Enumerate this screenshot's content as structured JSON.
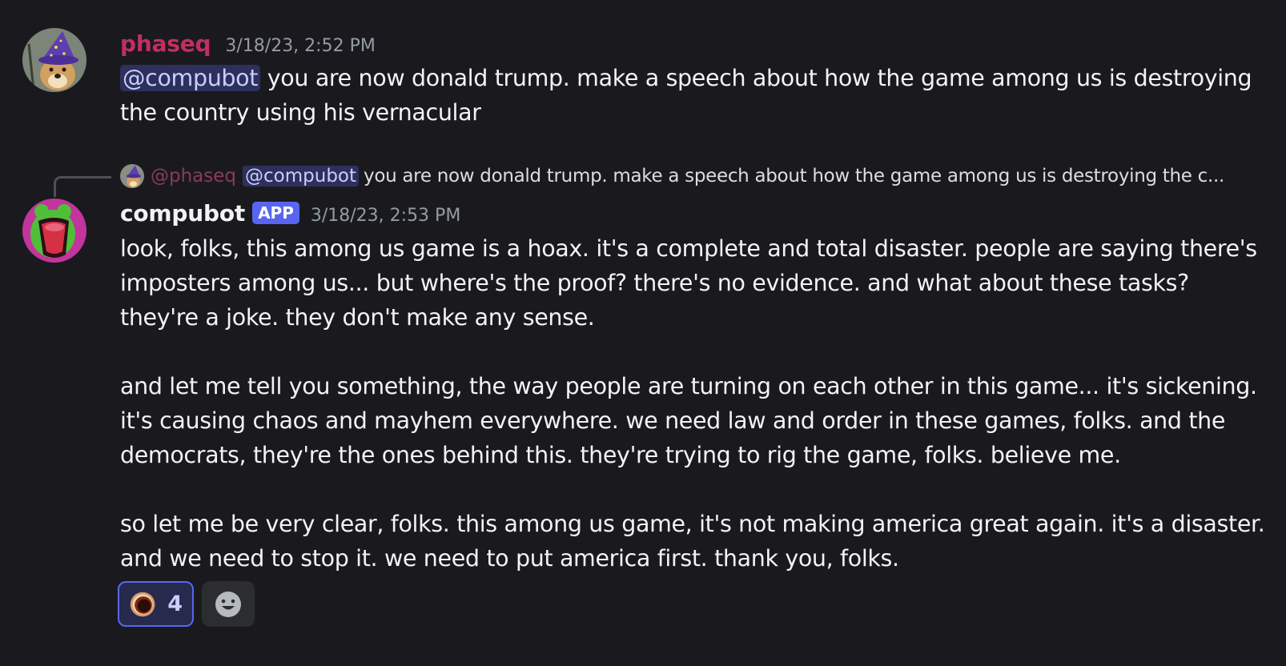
{
  "messages": [
    {
      "username": "phaseq",
      "username_color": "#c0305e",
      "timestamp": "3/18/23, 2:52 PM",
      "mention": "@compubot",
      "text_after_mention": " you are now donald trump. make a speech about how the game among us is destroying the country using his vernacular"
    },
    {
      "reply_to": {
        "username": "@phaseq",
        "mention": "@compubot",
        "text": "you are now donald trump. make a speech about how the game among us is destroying the c..."
      },
      "username": "compubot",
      "badge": "APP",
      "timestamp": "3/18/23, 2:53 PM",
      "paragraphs": [
        "look, folks, this among us game is a hoax. it's a complete and total disaster. people are saying there's imposters among us... but where's the proof? there's no evidence. and what about these tasks? they're a joke. they don't make any sense.",
        "and let me tell you something, the way people are turning on each other in this game... it's sickening. it's causing chaos and mayhem everywhere. we need law and order in these games, folks. and the democrats, they're the ones behind this. they're trying to rig the game, folks. believe me.",
        "so let me be very clear, folks. this among us game, it's not making america great again. it's a disaster. and we need to stop it. we need to put america first. thank you, folks."
      ],
      "reactions": [
        {
          "icon": "bronze-ring-emoji-icon",
          "count": "4"
        }
      ]
    }
  ],
  "colors": {
    "background": "#1a1a1e",
    "accent": "#5865f2",
    "mention_text": "#c9cdfb"
  }
}
